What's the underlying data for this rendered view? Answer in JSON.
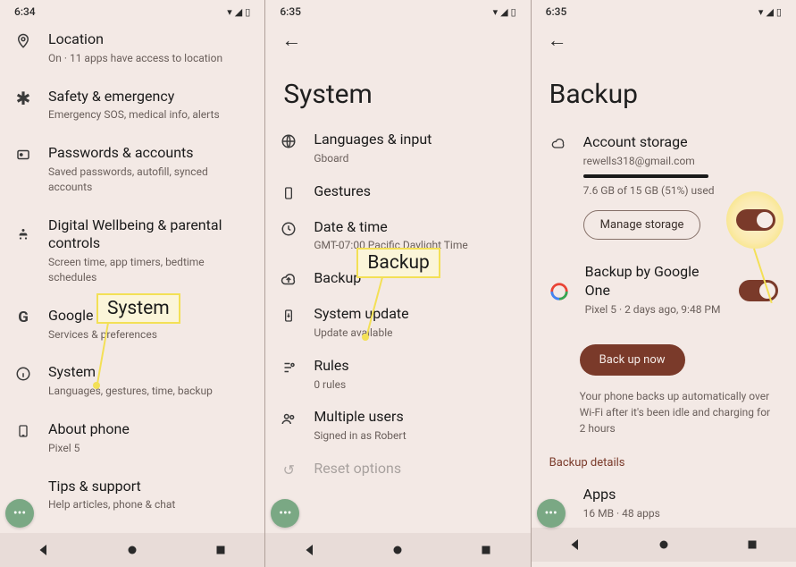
{
  "screens": {
    "settings": {
      "time": "6:34",
      "items": [
        {
          "title": "Location",
          "sub": "On · 11 apps have access to location"
        },
        {
          "title": "Safety & emergency",
          "sub": "Emergency SOS, medical info, alerts"
        },
        {
          "title": "Passwords & accounts",
          "sub": "Saved passwords, autofill, synced accounts"
        },
        {
          "title": "Digital Wellbeing & parental controls",
          "sub": "Screen time, app timers, bedtime schedules"
        },
        {
          "title": "Google",
          "sub": "Services & preferences"
        },
        {
          "title": "System",
          "sub": "Languages, gestures, time, backup"
        },
        {
          "title": "About phone",
          "sub": "Pixel 5"
        },
        {
          "title": "Tips & support",
          "sub": "Help articles, phone & chat"
        }
      ]
    },
    "system": {
      "time": "6:35",
      "title": "System",
      "items": [
        {
          "title": "Languages & input",
          "sub": "Gboard"
        },
        {
          "title": "Gestures",
          "sub": ""
        },
        {
          "title": "Date & time",
          "sub": "GMT-07:00 Pacific Daylight Time"
        },
        {
          "title": "Backup",
          "sub": ""
        },
        {
          "title": "System update",
          "sub": "Update available"
        },
        {
          "title": "Rules",
          "sub": "0 rules"
        },
        {
          "title": "Multiple users",
          "sub": "Signed in as Robert"
        },
        {
          "title": "Reset options",
          "sub": ""
        }
      ]
    },
    "backup": {
      "time": "6:35",
      "title": "Backup",
      "storage": {
        "label": "Account storage",
        "account": "rewells318@gmail.com",
        "usage": "7.6 GB of 15 GB (51%) used",
        "manage": "Manage storage"
      },
      "google_one": {
        "label": "Backup by Google One",
        "sub": "Pixel 5 · 2 days ago, 9:48 PM",
        "action": "Back up now",
        "help": "Your phone backs up automatically over Wi-Fi after it's been idle and charging for 2 hours"
      },
      "details_label": "Backup details",
      "apps": {
        "title": "Apps",
        "sub": "16 MB · 48 apps"
      }
    }
  },
  "callouts": {
    "system": "System",
    "backup": "Backup"
  }
}
